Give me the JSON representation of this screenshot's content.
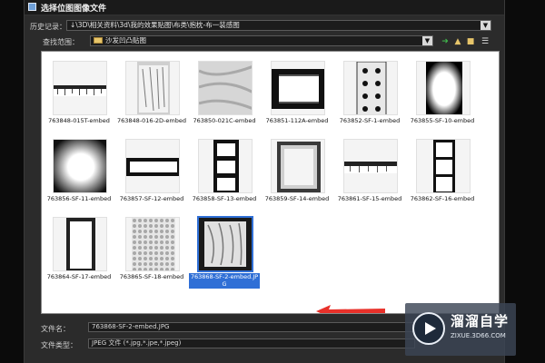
{
  "dialog": {
    "title": "选择位图图像文件",
    "history_label": "历史记录：",
    "history_path": "↓\\3D\\相关资料\\3d\\我的效果贴图\\布类\\抱枕-布一装感图",
    "lookin_label": "查找范围：",
    "lookin_value": "沙发凹凸贴图"
  },
  "files": [
    {
      "name": "763848-015T-embed"
    },
    {
      "name": "763848-016-2D-embed"
    },
    {
      "name": "763850-021C-embed"
    },
    {
      "name": "763851-112A-embed"
    },
    {
      "name": "763852-SF-1-embed"
    },
    {
      "name": "763855-SF-10-embed"
    },
    {
      "name": "763856-SF-11-embed"
    },
    {
      "name": "763857-SF-12-embed"
    },
    {
      "name": "763858-SF-13-embed"
    },
    {
      "name": "763859-SF-14-embed"
    },
    {
      "name": "763861-SF-15-embed"
    },
    {
      "name": "763862-SF-16-embed"
    },
    {
      "name": "763864-SF-17-embed"
    },
    {
      "name": "763865-SF-18-embed"
    },
    {
      "name": "763868-SF-2-embed.JPG",
      "selected": true
    }
  ],
  "footer": {
    "filename_label": "文件名：",
    "filename_value": "763868-SF-2-embed.JPG",
    "filetype_label": "文件类型：",
    "filetype_value": "JPEG 文件 (*.jpg,*.jpe,*.jpeg)"
  },
  "watermark": {
    "text": "溜溜自学",
    "url": "ZIXUE.3D66.COM"
  },
  "icons": [
    "back-icon",
    "up-folder-icon",
    "new-folder-icon",
    "view-menu-icon"
  ],
  "colors": {
    "selection": "#2f6fd6",
    "arrow": "#e8312a"
  }
}
